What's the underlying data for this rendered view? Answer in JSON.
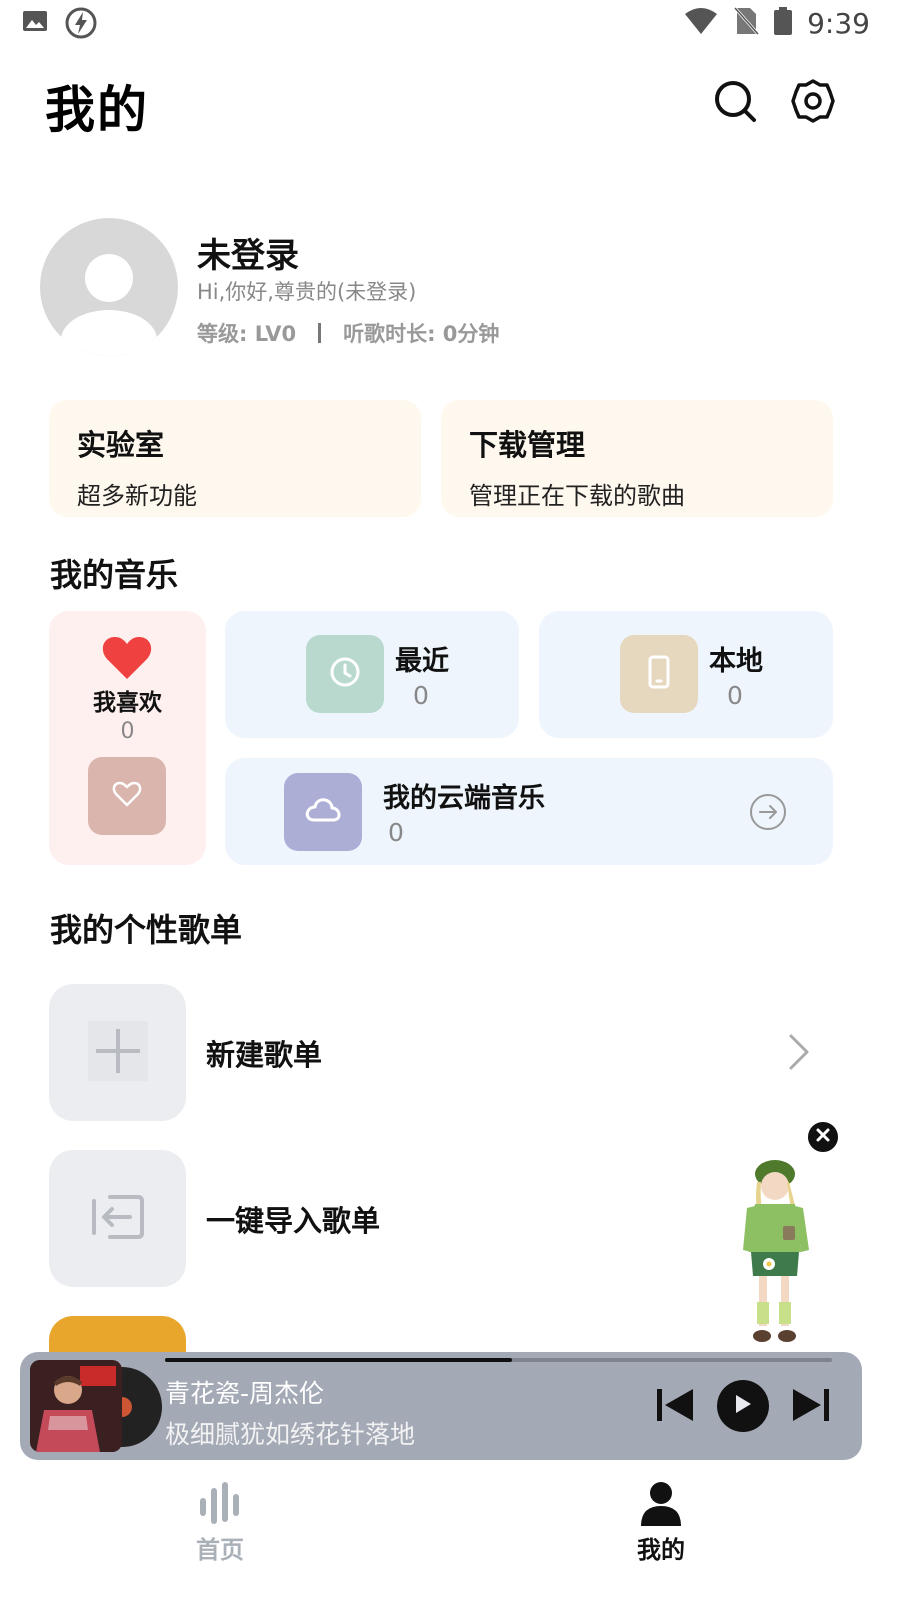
{
  "status_bar": {
    "time": "9:39",
    "left_icons": [
      "image-icon",
      "flash-circle-icon"
    ],
    "right_icons": [
      "wifi-icon",
      "no-sim-icon",
      "battery-icon"
    ]
  },
  "header": {
    "title": "我的",
    "search_icon": "search-icon",
    "settings_icon": "gear-icon"
  },
  "profile": {
    "name": "未登录",
    "greeting": "Hi,你好,尊贵的(未登录)",
    "level": "等级: LV0",
    "listen_time": "听歌时长: 0分钟"
  },
  "quick_cards": [
    {
      "title": "实验室",
      "subtitle": "超多新功能"
    },
    {
      "title": "下载管理",
      "subtitle": "管理正在下载的歌曲"
    }
  ],
  "my_music": {
    "section_title": "我的音乐",
    "favorites": {
      "label": "我喜欢",
      "count": "0"
    },
    "recent": {
      "label": "最近",
      "count": "0"
    },
    "local": {
      "label": "本地",
      "count": "0"
    },
    "cloud": {
      "label": "我的云端音乐",
      "count": "0"
    }
  },
  "playlists": {
    "section_title": "我的个性歌单",
    "items": [
      {
        "label": "新建歌单"
      },
      {
        "label": "一键导入歌单"
      }
    ]
  },
  "player": {
    "song_title": "青花瓷-周杰伦",
    "lyric": "极细腻犹如绣花针落地",
    "progress": 0.52
  },
  "bottom_nav": [
    {
      "label": "首页",
      "active": false
    },
    {
      "label": "我的",
      "active": true
    }
  ],
  "colors": {
    "accent_heart": "#f04141",
    "card_warm": "#fff8ee",
    "card_blue": "#eef5fd",
    "card_pink": "#fff0f0",
    "recent_icon_bg": "#b9d9cf",
    "local_icon_bg": "#e6d7bf",
    "cloud_icon_bg": "#adaed6",
    "player_bg": "#a4a9b6",
    "nav_inactive": "#aab0b8"
  }
}
